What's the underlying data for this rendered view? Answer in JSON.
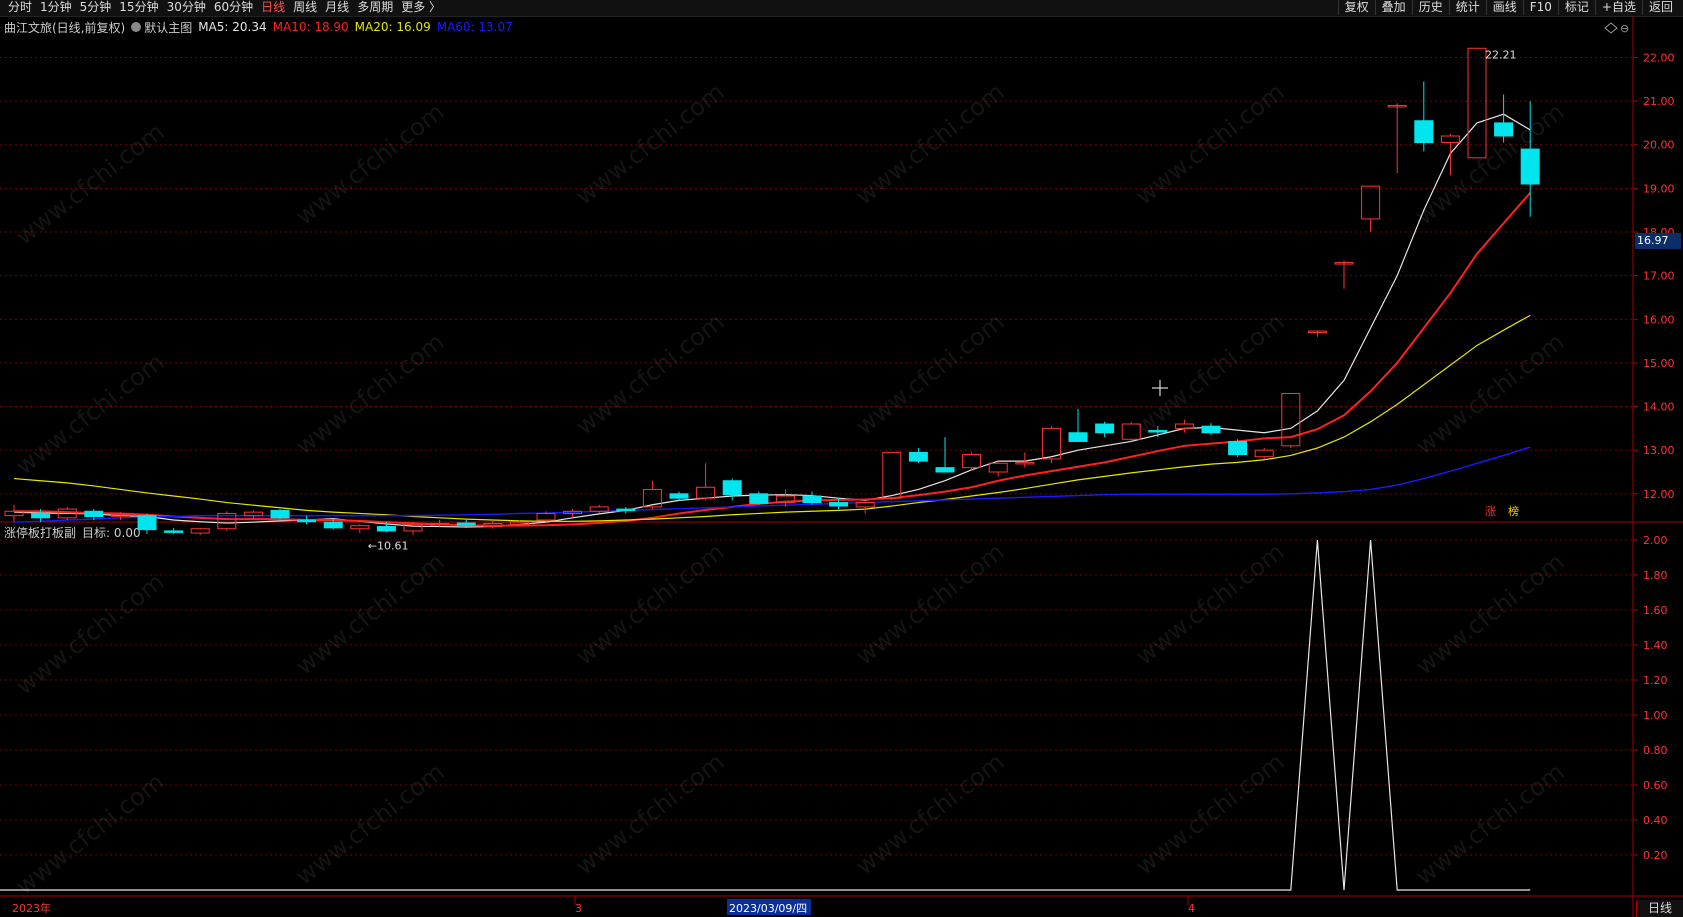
{
  "toolbar": {
    "periods": [
      "分时",
      "1分钟",
      "5分钟",
      "15分钟",
      "30分钟",
      "60分钟",
      "日线",
      "周线",
      "月线",
      "多周期",
      "更多 〉"
    ],
    "active_period": "日线",
    "right_buttons": [
      "复权",
      "叠加",
      "历史",
      "统计",
      "画线",
      "F10",
      "标记",
      "+自选",
      "返回"
    ]
  },
  "main_header": {
    "stock": "曲江文旅(日线,前复权)",
    "indicator": "默认主图",
    "ma5": "MA5: 20.34",
    "ma10": "MA10: 18.90",
    "ma20": "MA20: 16.09",
    "ma60": "MA60: 13.07"
  },
  "sub_header": {
    "indicator": "涨停板打板副",
    "target": "目标: 0.00"
  },
  "annotations": {
    "high_label": "22.21",
    "low_label": "←10.61",
    "zhang": "涨",
    "bang": "榜"
  },
  "price_tag": "16.97",
  "period_tag": "日线",
  "x_axis": {
    "labels": [
      "2023年",
      "3",
      "2023/03/09/四",
      "4"
    ]
  },
  "watermark": "www.cfchi.com",
  "colors": {
    "up": "#ff3333",
    "down": "#00e5ee",
    "ma5": "#e6e6e6",
    "ma10": "#ff2020",
    "ma20": "#e6e600",
    "ma60": "#1a1aff",
    "grid": "#7a0000"
  },
  "chart_data": [
    {
      "type": "candlestick",
      "title": "曲江文旅(日线,前复权)",
      "y_ticks": [
        "22.00",
        "21.00",
        "20.00",
        "19.00",
        "18.00",
        "17.00",
        "16.00",
        "15.00",
        "14.00",
        "13.00",
        "12.00"
      ],
      "ylim": [
        11.4,
        22.4
      ],
      "candles": [
        [
          11.5,
          11.75,
          11.35,
          11.6
        ],
        [
          11.55,
          11.65,
          11.35,
          11.45
        ],
        [
          11.45,
          11.7,
          11.4,
          11.65
        ],
        [
          11.6,
          11.65,
          11.4,
          11.48
        ],
        [
          11.5,
          11.58,
          11.4,
          11.52
        ],
        [
          11.5,
          11.55,
          11.08,
          11.18
        ],
        [
          11.15,
          11.22,
          11.08,
          11.12
        ],
        [
          11.1,
          11.22,
          11.05,
          11.2
        ],
        [
          11.2,
          11.6,
          11.15,
          11.55
        ],
        [
          11.5,
          11.62,
          11.4,
          11.58
        ],
        [
          11.62,
          11.65,
          11.42,
          11.45
        ],
        [
          11.4,
          11.5,
          11.3,
          11.36
        ],
        [
          11.35,
          11.42,
          11.18,
          11.22
        ],
        [
          11.2,
          11.3,
          11.1,
          11.27
        ],
        [
          11.25,
          11.35,
          11.12,
          11.15
        ],
        [
          11.15,
          11.35,
          11.05,
          11.3
        ],
        [
          11.3,
          11.4,
          11.25,
          11.32
        ],
        [
          11.33,
          11.4,
          11.25,
          11.28
        ],
        [
          11.25,
          11.38,
          11.2,
          11.32
        ],
        [
          11.3,
          11.4,
          11.25,
          11.35
        ],
        [
          11.4,
          11.6,
          11.35,
          11.55
        ],
        [
          11.55,
          11.65,
          11.45,
          11.6
        ],
        [
          11.6,
          11.75,
          11.55,
          11.7
        ],
        [
          11.65,
          11.7,
          11.55,
          11.62
        ],
        [
          11.7,
          12.3,
          11.65,
          12.1
        ],
        [
          12.0,
          12.05,
          11.85,
          11.9
        ],
        [
          11.9,
          12.7,
          11.85,
          12.15
        ],
        [
          12.3,
          12.35,
          11.85,
          11.98
        ],
        [
          12.0,
          12.05,
          11.75,
          11.78
        ],
        [
          11.8,
          12.1,
          11.7,
          11.95
        ],
        [
          11.95,
          12.05,
          11.75,
          11.8
        ],
        [
          11.8,
          11.9,
          11.65,
          11.72
        ],
        [
          11.7,
          11.85,
          11.55,
          11.8
        ],
        [
          11.9,
          12.95,
          11.85,
          12.95
        ],
        [
          12.95,
          13.05,
          12.7,
          12.75
        ],
        [
          12.6,
          13.3,
          12.5,
          12.5
        ],
        [
          12.6,
          12.95,
          12.55,
          12.9
        ],
        [
          12.5,
          12.75,
          12.4,
          12.7
        ],
        [
          12.7,
          12.95,
          12.6,
          12.72
        ],
        [
          12.8,
          13.55,
          12.7,
          13.5
        ],
        [
          13.4,
          13.95,
          13.3,
          13.2
        ],
        [
          13.6,
          13.65,
          13.3,
          13.4
        ],
        [
          13.25,
          13.65,
          13.2,
          13.6
        ],
        [
          13.45,
          13.55,
          13.3,
          13.42
        ],
        [
          13.5,
          13.7,
          13.4,
          13.6
        ],
        [
          13.55,
          13.62,
          13.35,
          13.4
        ],
        [
          13.2,
          13.25,
          12.85,
          12.9
        ],
        [
          12.85,
          13.05,
          12.8,
          13.0
        ],
        [
          13.1,
          14.3,
          13.05,
          14.3
        ],
        [
          15.73,
          15.73,
          15.6,
          15.73
        ],
        [
          17.3,
          17.35,
          16.7,
          17.3
        ],
        [
          18.3,
          19.05,
          18.0,
          19.05
        ],
        [
          20.9,
          20.95,
          19.35,
          20.9
        ],
        [
          20.55,
          21.45,
          19.85,
          20.05
        ],
        [
          20.05,
          20.25,
          19.3,
          20.2
        ],
        [
          19.7,
          22.21,
          19.7,
          22.21
        ],
        [
          20.5,
          21.15,
          20.05,
          20.2
        ],
        [
          19.9,
          21.0,
          18.35,
          19.1
        ]
      ],
      "series": [
        {
          "name": "MA5",
          "values": [
            11.58,
            11.56,
            11.55,
            11.54,
            11.5,
            11.48,
            11.4,
            11.36,
            11.33,
            11.35,
            11.38,
            11.4,
            11.43,
            11.37,
            11.31,
            11.26,
            11.25,
            11.24,
            11.25,
            11.3,
            11.35,
            11.45,
            11.54,
            11.62,
            11.75,
            11.85,
            11.9,
            11.95,
            11.97,
            11.98,
            11.96,
            11.9,
            11.85,
            11.96,
            12.1,
            12.3,
            12.55,
            12.75,
            12.75,
            12.85,
            13.0,
            13.1,
            13.2,
            13.35,
            13.5,
            13.52,
            13.46,
            13.4,
            13.5,
            13.9,
            14.6,
            15.8,
            17.0,
            18.5,
            19.8,
            20.5,
            20.7,
            20.34
          ]
        },
        {
          "name": "MA10",
          "values": [
            11.6,
            11.6,
            11.58,
            11.56,
            11.55,
            11.52,
            11.48,
            11.45,
            11.42,
            11.42,
            11.42,
            11.4,
            11.4,
            11.38,
            11.35,
            11.32,
            11.3,
            11.28,
            11.27,
            11.27,
            11.28,
            11.3,
            11.33,
            11.38,
            11.45,
            11.55,
            11.63,
            11.7,
            11.77,
            11.82,
            11.85,
            11.86,
            11.87,
            11.9,
            11.97,
            12.05,
            12.15,
            12.3,
            12.42,
            12.52,
            12.62,
            12.72,
            12.85,
            12.98,
            13.1,
            13.15,
            13.2,
            13.27,
            13.3,
            13.48,
            13.8,
            14.35,
            15.0,
            15.8,
            16.6,
            17.5,
            18.2,
            18.9
          ]
        },
        {
          "name": "MA20",
          "values": [
            12.35,
            12.3,
            12.25,
            12.18,
            12.1,
            12.02,
            11.95,
            11.88,
            11.8,
            11.74,
            11.68,
            11.62,
            11.58,
            11.55,
            11.52,
            11.48,
            11.45,
            11.42,
            11.4,
            11.38,
            11.37,
            11.37,
            11.38,
            11.4,
            11.42,
            11.45,
            11.48,
            11.52,
            11.55,
            11.58,
            11.6,
            11.62,
            11.65,
            11.72,
            11.8,
            11.87,
            11.95,
            12.03,
            12.12,
            12.22,
            12.32,
            12.4,
            12.48,
            12.55,
            12.62,
            12.68,
            12.72,
            12.78,
            12.88,
            13.05,
            13.3,
            13.65,
            14.05,
            14.5,
            14.95,
            15.4,
            15.75,
            16.09
          ]
        },
        {
          "name": "MA60",
          "values": [
            11.35,
            11.37,
            11.4,
            11.42,
            11.45,
            11.47,
            11.48,
            11.5,
            11.5,
            11.5,
            11.5,
            11.5,
            11.5,
            11.5,
            11.5,
            11.5,
            11.51,
            11.52,
            11.53,
            11.55,
            11.56,
            11.58,
            11.6,
            11.62,
            11.64,
            11.66,
            11.68,
            11.7,
            11.72,
            11.74,
            11.76,
            11.78,
            11.8,
            11.82,
            11.84,
            11.86,
            11.88,
            11.9,
            11.92,
            11.94,
            11.96,
            11.98,
            11.99,
            11.99,
            11.99,
            11.99,
            11.99,
            11.99,
            12.0,
            12.02,
            12.05,
            12.1,
            12.2,
            12.35,
            12.52,
            12.7,
            12.88,
            13.07
          ]
        }
      ]
    },
    {
      "type": "line",
      "title": "涨停板打板副",
      "y_ticks": [
        "2.00",
        "1.80",
        "1.60",
        "1.40",
        "1.20",
        "1.00",
        "0.80",
        "0.60",
        "0.40",
        "0.20"
      ],
      "ylim": [
        0,
        2.0
      ],
      "series": [
        {
          "name": "目标",
          "values": [
            0,
            0,
            0,
            0,
            0,
            0,
            0,
            0,
            0,
            0,
            0,
            0,
            0,
            0,
            0,
            0,
            0,
            0,
            0,
            0,
            0,
            0,
            0,
            0,
            0,
            0,
            0,
            0,
            0,
            0,
            0,
            0,
            0,
            0,
            0,
            0,
            0,
            0,
            0,
            0,
            0,
            0,
            0,
            0,
            0,
            0,
            0,
            0,
            0,
            2,
            0,
            2,
            0,
            0,
            0,
            0,
            0,
            0
          ]
        }
      ]
    }
  ]
}
